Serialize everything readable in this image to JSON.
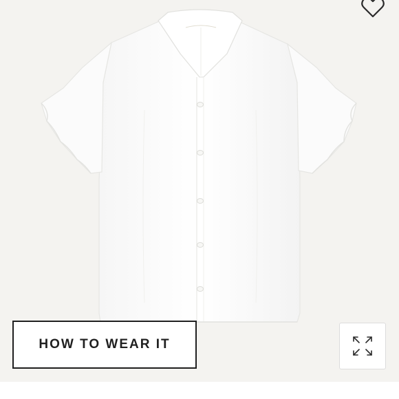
{
  "product": {
    "image_subject": "shirt"
  },
  "actions": {
    "how_to_wear_label": "HOW TO WEAR IT",
    "wishlist_icon": "heart-outline-icon",
    "expand_icon": "expand-arrows-icon"
  },
  "colors": {
    "photo_background": "#f4f3f0",
    "shirt": "#ffffff",
    "button_border": "#1f1f1f",
    "button_text": "#1f1f1f"
  }
}
